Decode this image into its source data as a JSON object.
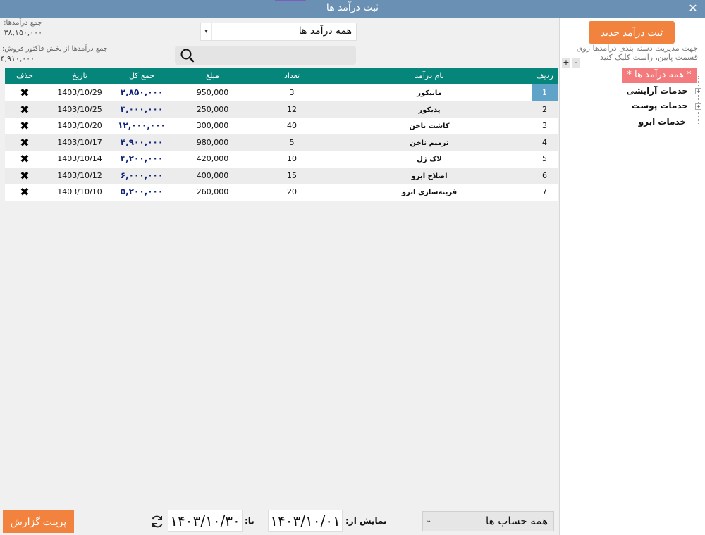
{
  "window": {
    "title": "ثبت درآمد ها",
    "close_icon": "close-icon"
  },
  "summary": {
    "total_label": "جمع درآمدها:",
    "total_value": "۳۸,۱۵۰,۰۰۰",
    "invoice_label": "جمع درآمدها از بخش فاکتور فروش:",
    "invoice_value": "۴,۹۱۰,۰۰۰"
  },
  "filter": {
    "category_value": "همه درآمد ها",
    "search_placeholder": "",
    "search_icon": "search-icon"
  },
  "table": {
    "headers": {
      "row": "ردیف",
      "name": "نام درآمد",
      "count": "تعداد",
      "amount": "مبلغ",
      "total": "جمع کل",
      "date": "تاریخ",
      "delete": "حذف"
    },
    "rows": [
      {
        "row": "1",
        "name": "مانیکور",
        "count": "3",
        "amount": "950,000",
        "total": "۲,۸۵۰,۰۰۰",
        "date": "1403/10/29",
        "delete": "✖"
      },
      {
        "row": "2",
        "name": "پدیکور",
        "count": "12",
        "amount": "250,000",
        "total": "۳,۰۰۰,۰۰۰",
        "date": "1403/10/25",
        "delete": "✖"
      },
      {
        "row": "3",
        "name": "کاشت ناخن",
        "count": "40",
        "amount": "300,000",
        "total": "۱۲,۰۰۰,۰۰۰",
        "date": "1403/10/20",
        "delete": "✖"
      },
      {
        "row": "4",
        "name": "ترمیم ناخن",
        "count": "5",
        "amount": "980,000",
        "total": "۴,۹۰۰,۰۰۰",
        "date": "1403/10/17",
        "delete": "✖"
      },
      {
        "row": "5",
        "name": "لاک ژل",
        "count": "10",
        "amount": "420,000",
        "total": "۴,۲۰۰,۰۰۰",
        "date": "1403/10/14",
        "delete": "✖"
      },
      {
        "row": "6",
        "name": "اصلاح ابرو",
        "count": "15",
        "amount": "400,000",
        "total": "۶,۰۰۰,۰۰۰",
        "date": "1403/10/12",
        "delete": "✖"
      },
      {
        "row": "7",
        "name": "قرینه‌سازی ابرو",
        "count": "20",
        "amount": "260,000",
        "total": "۵,۲۰۰,۰۰۰",
        "date": "1403/10/10",
        "delete": "✖"
      }
    ]
  },
  "sidebar": {
    "new_button": "ثبت درآمد جدید",
    "hint": "جهت مدیریت دسته بندی درآمدها روی قسمت پایین، راست کلیک کنید",
    "plus": "+",
    "minus": "-",
    "tree_root": "* همه درآمد ها *",
    "tree_items": [
      "خدمات آرایشی",
      "خدمات پوست",
      "خدمات ابرو"
    ]
  },
  "footer": {
    "print_button": "پرینت گزارش",
    "refresh_icon": "refresh-icon",
    "to_label": "تا:",
    "to_date": "۱۴۰۳/۱۰/۳۰",
    "from_label": "نمایش از:",
    "from_date": "۱۴۰۳/۱۰/۰۱",
    "account_value": "همه حساب ها"
  },
  "colors": {
    "titlebar": "#6a90b3",
    "header": "#06857b",
    "accent": "#f1833f",
    "tree_root": "#f37b7d",
    "selected_row": "#5fa3c9",
    "total_text": "#10247a"
  }
}
